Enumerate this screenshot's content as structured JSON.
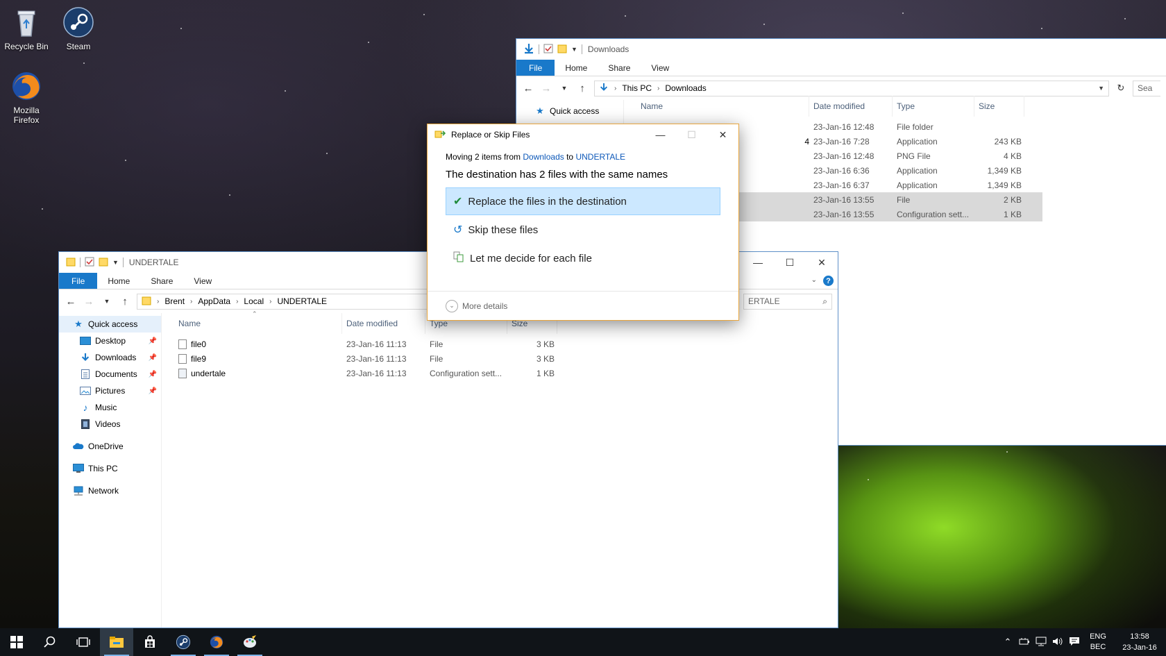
{
  "desktop": {
    "icons": [
      {
        "label": "Recycle Bin"
      },
      {
        "label": "Steam"
      },
      {
        "label": "Mozilla Firefox"
      }
    ]
  },
  "downloads_window": {
    "title": "Downloads",
    "ribbon_tabs": [
      "File",
      "Home",
      "Share",
      "View"
    ],
    "breadcrumb": [
      "This PC",
      "Downloads"
    ],
    "search_placeholder": "Sea",
    "nav": {
      "quick_access": "Quick access"
    },
    "columns": {
      "name": "Name",
      "date": "Date modified",
      "type": "Type",
      "size": "Size"
    },
    "rows": [
      {
        "name": "",
        "date": "23-Jan-16 12:48",
        "type": "File folder",
        "size": ""
      },
      {
        "name": "4",
        "date": "23-Jan-16 7:28",
        "type": "Application",
        "size": "243 KB"
      },
      {
        "name": "",
        "date": "23-Jan-16 12:48",
        "type": "PNG File",
        "size": "4 KB"
      },
      {
        "name": "",
        "date": "23-Jan-16 6:36",
        "type": "Application",
        "size": "1,349 KB"
      },
      {
        "name": "",
        "date": "23-Jan-16 6:37",
        "type": "Application",
        "size": "1,349 KB"
      },
      {
        "name": "",
        "date": "23-Jan-16 13:55",
        "type": "File",
        "size": "2 KB"
      },
      {
        "name": "",
        "date": "23-Jan-16 13:55",
        "type": "Configuration sett...",
        "size": "1 KB"
      }
    ]
  },
  "undertale_window": {
    "title": "UNDERTALE",
    "ribbon_tabs": [
      "File",
      "Home",
      "Share",
      "View"
    ],
    "breadcrumb": [
      "Brent",
      "AppData",
      "Local",
      "UNDERTALE"
    ],
    "search_text": "ERTALE",
    "nav": {
      "quick_access": "Quick access",
      "desktop": "Desktop",
      "downloads": "Downloads",
      "documents": "Documents",
      "pictures": "Pictures",
      "music": "Music",
      "videos": "Videos",
      "onedrive": "OneDrive",
      "this_pc": "This PC",
      "network": "Network"
    },
    "columns": {
      "name": "Name",
      "date": "Date modified",
      "type": "Type",
      "size": "Size"
    },
    "rows": [
      {
        "name": "file0",
        "date": "23-Jan-16 11:13",
        "type": "File",
        "size": "3 KB"
      },
      {
        "name": "file9",
        "date": "23-Jan-16 11:13",
        "type": "File",
        "size": "3 KB"
      },
      {
        "name": "undertale",
        "date": "23-Jan-16 11:13",
        "type": "Configuration sett...",
        "size": "1 KB"
      }
    ]
  },
  "dialog": {
    "title": "Replace or Skip Files",
    "moving_prefix": "Moving 2 items from",
    "source": "Downloads",
    "to_word": "to",
    "destination": "UNDERTALE",
    "message": "The destination has 2 files with the same names",
    "options": {
      "replace": "Replace the files in the destination",
      "skip": "Skip these files",
      "decide": "Let me decide for each file"
    },
    "more_details": "More details"
  },
  "taskbar": {
    "language": {
      "line1": "ENG",
      "line2": "BEC"
    },
    "clock": {
      "time": "13:58",
      "date": "23-Jan-16"
    }
  },
  "colors": {
    "accent": "#1979ca",
    "selection": "#cce8ff",
    "dialog_border": "#e8a53c",
    "taskbar": "#101418"
  }
}
